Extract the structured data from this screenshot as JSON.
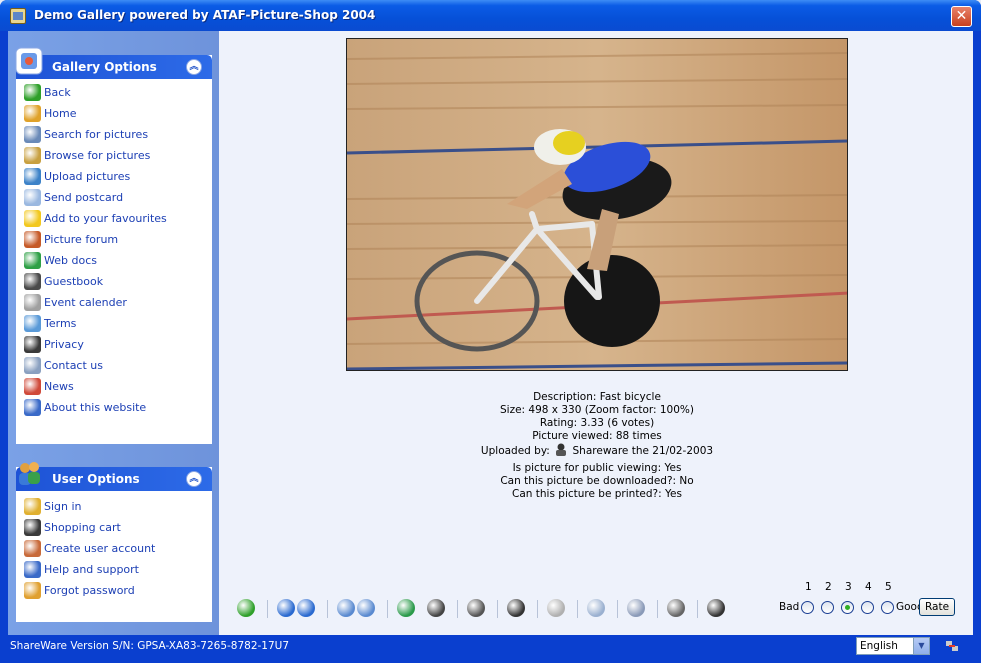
{
  "window": {
    "title": "Demo Gallery powered by ATAF-Picture-Shop 2004"
  },
  "gallery_options": {
    "title": "Gallery Options",
    "items": [
      {
        "label": "Back",
        "icon": "back-arrow-icon",
        "color": "#2fa02a"
      },
      {
        "label": "Home",
        "icon": "home-icon",
        "color": "#e0a22a"
      },
      {
        "label": "Search for pictures",
        "icon": "magnifier-icon",
        "color": "#6a8ab8"
      },
      {
        "label": "Browse for pictures",
        "icon": "browse-icon",
        "color": "#c8a040"
      },
      {
        "label": "Upload pictures",
        "icon": "upload-icon",
        "color": "#3c82c8"
      },
      {
        "label": "Send postcard",
        "icon": "postcard-icon",
        "color": "#9ab8e0"
      },
      {
        "label": "Add to your favourites",
        "icon": "star-icon",
        "color": "#f2c81e"
      },
      {
        "label": "Picture forum",
        "icon": "people-icon",
        "color": "#c65a28"
      },
      {
        "label": "Web docs",
        "icon": "globe-doc-icon",
        "color": "#2ea046"
      },
      {
        "label": "Guestbook",
        "icon": "guestbook-icon",
        "color": "#4a4a4a"
      },
      {
        "label": "Event calender",
        "icon": "calendar-icon",
        "color": "#a0a0a0"
      },
      {
        "label": "Terms",
        "icon": "terms-icon",
        "color": "#5a9ad8"
      },
      {
        "label": "Privacy",
        "icon": "privacy-icon",
        "color": "#3a3a3a"
      },
      {
        "label": "Contact us",
        "icon": "contact-icon",
        "color": "#8aa0c0"
      },
      {
        "label": "News",
        "icon": "news-icon",
        "color": "#d04a3a"
      },
      {
        "label": "About this website",
        "icon": "help-icon",
        "color": "#3a6ac8"
      }
    ]
  },
  "user_options": {
    "title": "User Options",
    "items": [
      {
        "label": "Sign in",
        "icon": "key-icon",
        "color": "#e0b030"
      },
      {
        "label": "Shopping cart",
        "icon": "cart-icon",
        "color": "#3a3a3a"
      },
      {
        "label": "Create user account",
        "icon": "user-add-icon",
        "color": "#c86a3a"
      },
      {
        "label": "Help and support",
        "icon": "help-icon",
        "color": "#3a6ac8"
      },
      {
        "label": "Forgot password",
        "icon": "password-icon",
        "color": "#e0a030"
      }
    ]
  },
  "picture": {
    "description": "Description: Fast bicycle",
    "size": "Size: 498 x 330 (Zoom factor: 100%)",
    "rating": "Rating: 3.33 (6 votes)",
    "viewed": "Picture viewed: 88 times",
    "uploaded_prefix": "Uploaded by:",
    "uploaded_by": "Shareware the 21/02-2003",
    "public": "Is picture for public viewing: Yes",
    "downloadable": "Can this picture be downloaded?: No",
    "printable": "Can this picture be printed?: Yes"
  },
  "toolbar": {
    "buttons": [
      {
        "name": "back-icon",
        "color": "#2fa02a"
      },
      {
        "name": "first-icon",
        "color": "#2a6ad0"
      },
      {
        "name": "next-icon",
        "color": "#2a6ad0"
      },
      {
        "name": "zoom-in-icon",
        "color": "#5a8ad0"
      },
      {
        "name": "zoom-out-icon",
        "color": "#5a8ad0"
      },
      {
        "name": "fit-icon",
        "color": "#2a9a4a"
      },
      {
        "name": "favourite-icon",
        "color": "#444444"
      },
      {
        "name": "forum-icon",
        "color": "#555555"
      },
      {
        "name": "author-icon",
        "color": "#333333"
      },
      {
        "name": "slideshow-icon",
        "color": "#b0b0b0"
      },
      {
        "name": "postcard-icon",
        "color": "#9ab0d0"
      },
      {
        "name": "print-icon",
        "color": "#8a9ab8"
      },
      {
        "name": "download-icon",
        "color": "#666666"
      },
      {
        "name": "add-cart-icon",
        "color": "#333333"
      }
    ],
    "rating": {
      "bad_label": "Bad",
      "good_label": "Good",
      "numbers": [
        "1",
        "2",
        "3",
        "4",
        "5"
      ],
      "selected": 3,
      "button": "Rate"
    }
  },
  "statusbar": {
    "text": "ShareWare Version S/N: GPSA-XA83-7265-8782-17U7",
    "language": "English"
  }
}
